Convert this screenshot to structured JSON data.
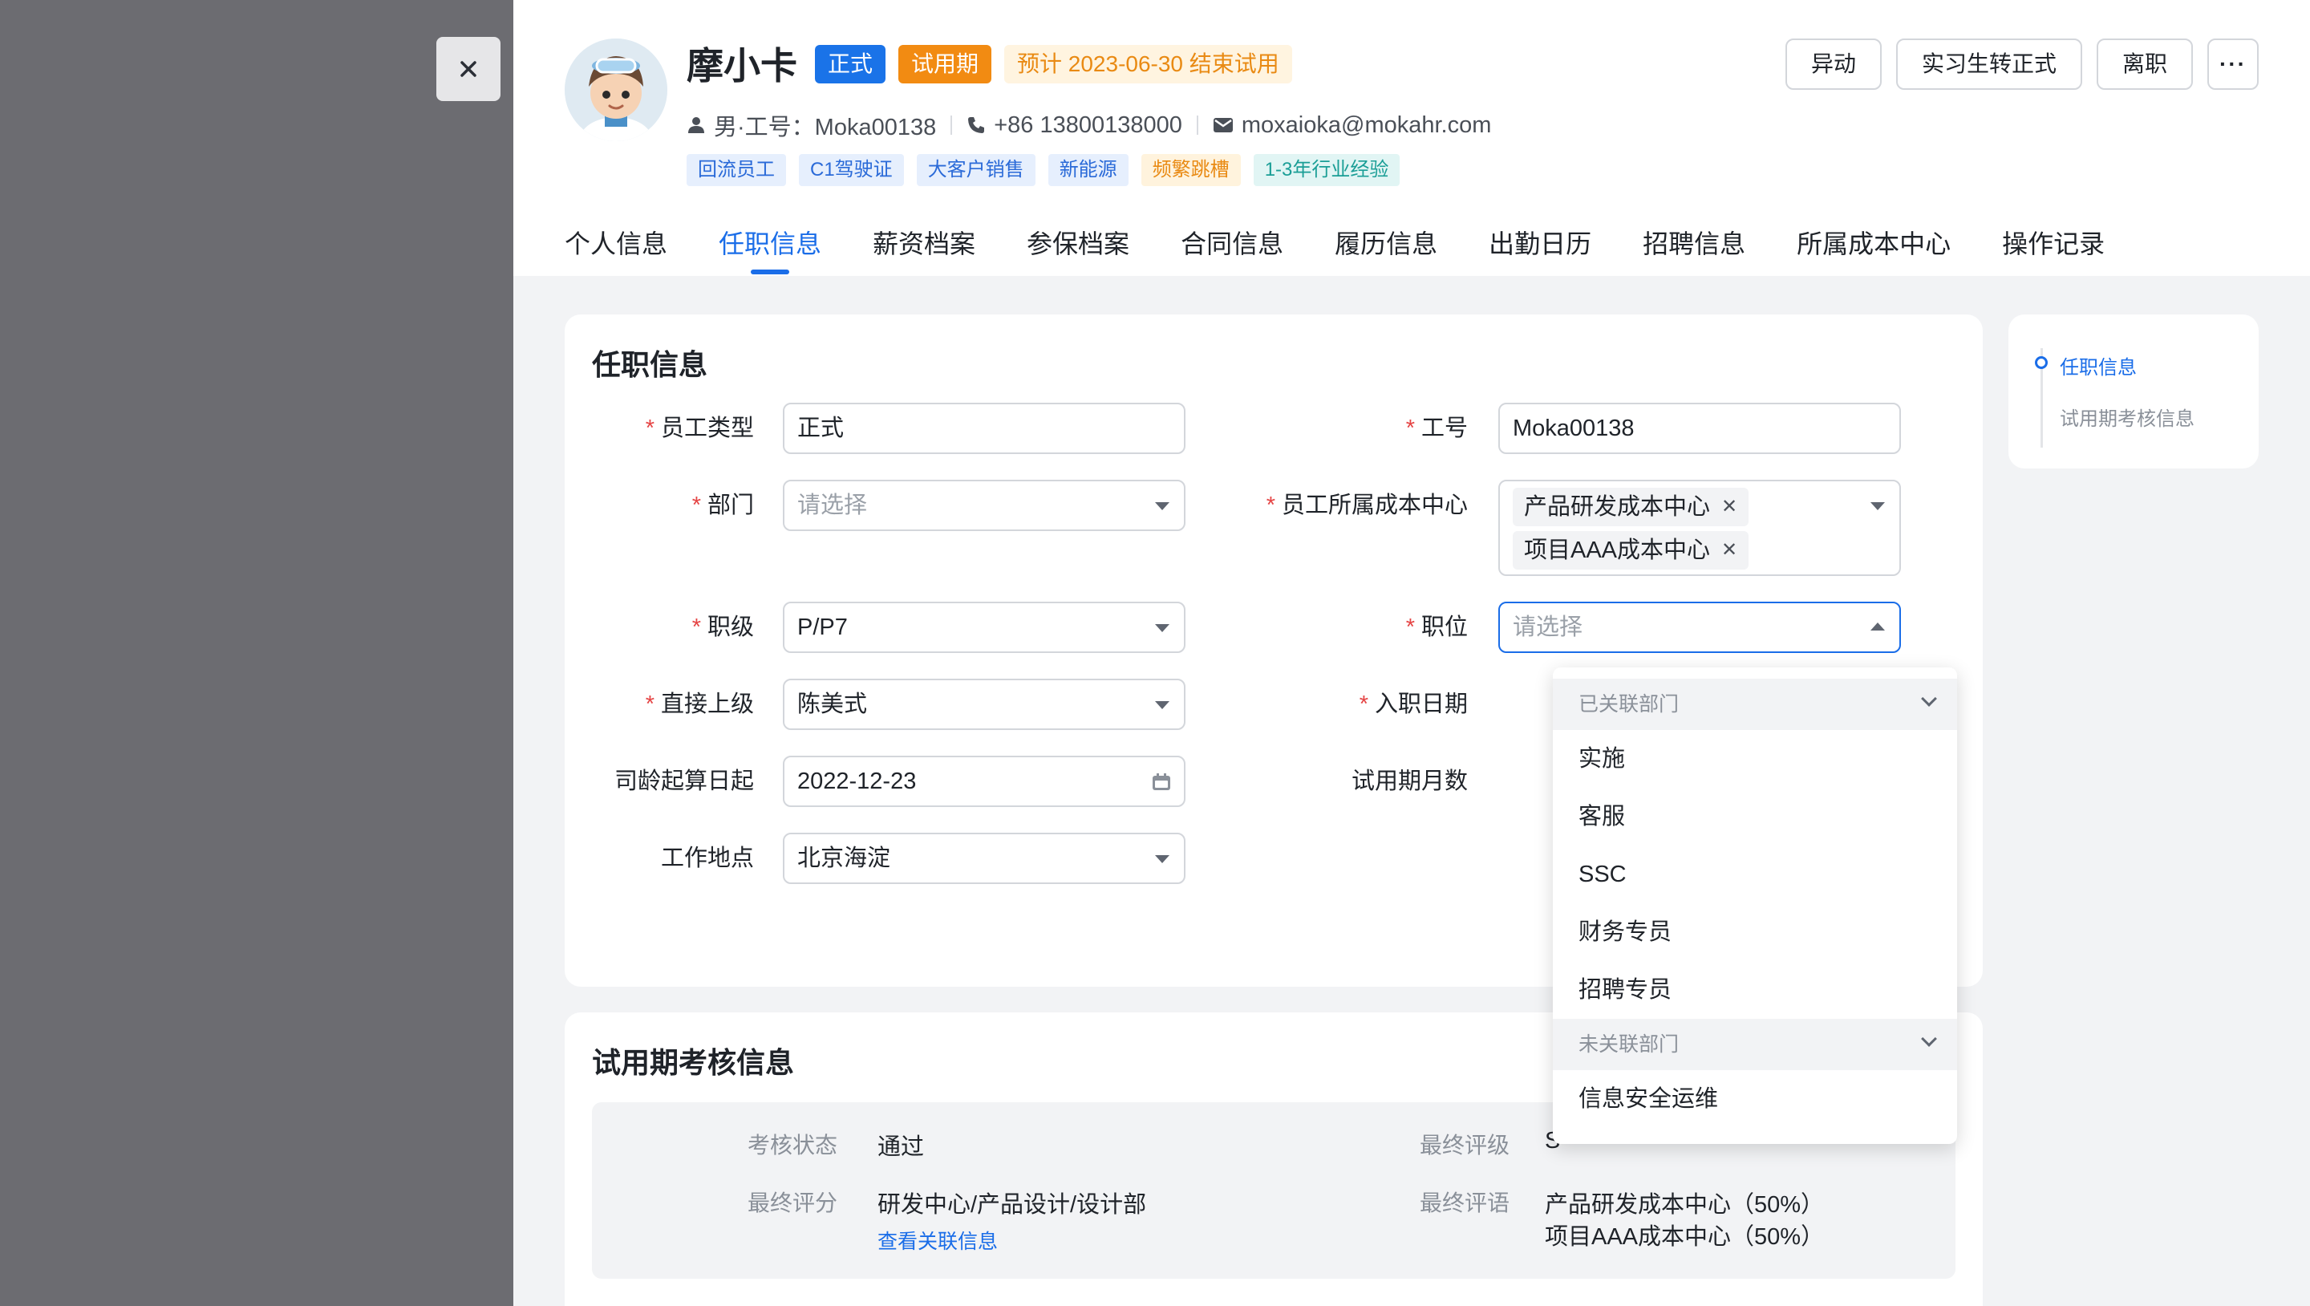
{
  "profile": {
    "name": "摩小卡",
    "status_tag": "正式",
    "trial_tag": "试用期",
    "trial_notice": "预计 2023-06-30 结束试用",
    "gender_id": "男·工号：Moka00138",
    "phone": "+86 13800138000",
    "email": "moxaioka@mokahr.com",
    "chips": [
      {
        "label": "回流员工",
        "color": "blue"
      },
      {
        "label": "C1驾驶证",
        "color": "blue"
      },
      {
        "label": "大客户销售",
        "color": "blue"
      },
      {
        "label": "新能源",
        "color": "blue"
      },
      {
        "label": "频繁跳槽",
        "color": "orange"
      },
      {
        "label": "1-3年行业经验",
        "color": "cyan"
      }
    ]
  },
  "actions": {
    "transfer": "异动",
    "intern_convert": "实习生转正式",
    "resign": "离职",
    "more": "···"
  },
  "tabs": [
    "个人信息",
    "任职信息",
    "薪资档案",
    "参保档案",
    "合同信息",
    "履历信息",
    "出勤日历",
    "招聘信息",
    "所属成本中心",
    "操作记录"
  ],
  "active_tab": "任职信息",
  "employment": {
    "title": "任职信息",
    "employee_type": {
      "label": "员工类型",
      "value": "正式"
    },
    "employee_id": {
      "label": "工号",
      "value": "Moka00138"
    },
    "department": {
      "label": "部门",
      "placeholder": "请选择"
    },
    "cost_center": {
      "label": "员工所属成本中心",
      "tags": [
        "产品研发成本中心",
        "项目AAA成本中心"
      ]
    },
    "level": {
      "label": "职级",
      "value": "P/P7"
    },
    "position": {
      "label": "职位",
      "placeholder": "请选择"
    },
    "supervisor": {
      "label": "直接上级",
      "value": "陈美式"
    },
    "hire_date": {
      "label": "入职日期"
    },
    "seniority_date": {
      "label": "司龄起算日起",
      "value": "2022-12-23"
    },
    "trial_months": {
      "label": "试用期月数"
    },
    "work_location": {
      "label": "工作地点",
      "value": "北京海淀"
    }
  },
  "position_dropdown": {
    "group_linked": "已关联部门",
    "linked_items": [
      "实施",
      "客服",
      "SSC",
      "财务专员",
      "招聘专员"
    ],
    "group_unlinked": "未关联部门",
    "unlinked_items": [
      "信息安全运维"
    ]
  },
  "trial": {
    "title": "试用期考核信息",
    "status_label": "考核状态",
    "status_value": "通过",
    "final_rating_label": "最终评级",
    "final_rating_value": "S",
    "final_score_label": "最终评分",
    "final_score_value": "研发中心/产品设计/设计部",
    "link": "查看关联信息",
    "final_comment_label": "最终评语",
    "final_comment_lines": [
      "产品研发成本中心（50%）",
      "项目AAA成本中心（50%）"
    ]
  },
  "anchors": {
    "items": [
      "任职信息",
      "试用期考核信息"
    ],
    "active": "任职信息"
  },
  "colors": {
    "primary": "#1a6de8",
    "orange": "#f28b12",
    "required": "#e54545",
    "overlay": "#6c6c71"
  }
}
